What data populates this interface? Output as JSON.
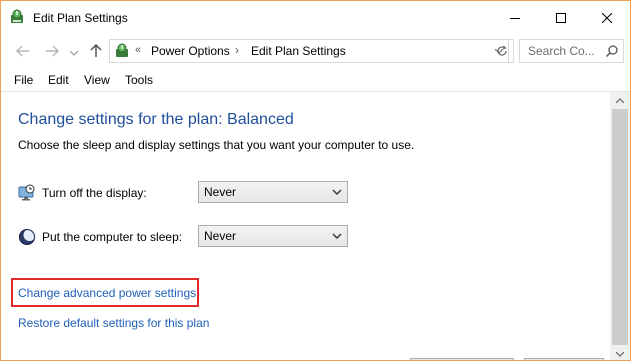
{
  "window": {
    "title": "Edit Plan Settings",
    "app_icon": "power-plan-icon"
  },
  "titlebar_buttons": {
    "minimize_icon": "minimize-icon",
    "maximize_icon": "maximize-icon",
    "close_icon": "close-icon"
  },
  "address_bar": {
    "chevron": "«",
    "breadcrumbs": [
      "Power Options",
      "Edit Plan Settings"
    ],
    "separator": "›"
  },
  "search": {
    "placeholder": "Search Co..."
  },
  "menu": {
    "items": [
      "File",
      "Edit",
      "View",
      "Tools"
    ]
  },
  "main": {
    "title": "Change settings for the plan: Balanced",
    "description": "Choose the sleep and display settings that you want your computer to use.",
    "settings": [
      {
        "label": "Turn off the display:",
        "value": "Never",
        "icon": "display-timer-icon"
      },
      {
        "label": "Put the computer to sleep:",
        "value": "Never",
        "icon": "sleep-moon-icon"
      }
    ],
    "links": {
      "advanced": "Change advanced power settings",
      "restore": "Restore default settings for this plan"
    }
  },
  "colors": {
    "title_blue": "#1e4e9a",
    "link_blue": "#1f5fb8",
    "highlight_red": "#e02a2a",
    "window_border": "#f2a154"
  }
}
